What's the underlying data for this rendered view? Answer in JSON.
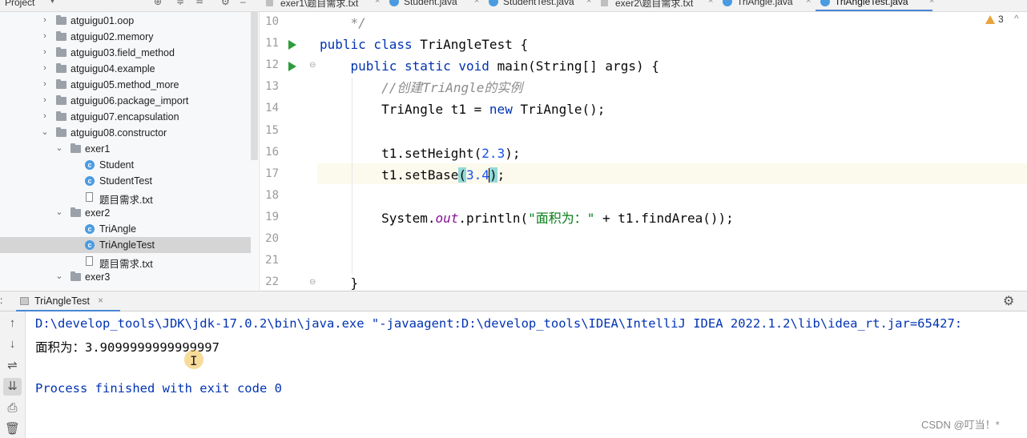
{
  "project_panel": {
    "title": "Project",
    "tree": [
      {
        "label": "atguigu01.oop",
        "type": "package",
        "expanded": false
      },
      {
        "label": "atguigu02.memory",
        "type": "package",
        "expanded": false
      },
      {
        "label": "atguigu03.field_method",
        "type": "package",
        "expanded": false
      },
      {
        "label": "atguigu04.example",
        "type": "package",
        "expanded": false
      },
      {
        "label": "atguigu05.method_more",
        "type": "package",
        "expanded": false
      },
      {
        "label": "atguigu06.package_import",
        "type": "package",
        "expanded": false
      },
      {
        "label": "atguigu07.encapsulation",
        "type": "package",
        "expanded": false
      },
      {
        "label": "atguigu08.constructor",
        "type": "package",
        "expanded": true
      },
      {
        "label": "exer1",
        "type": "package",
        "expanded": true
      },
      {
        "label": "Student",
        "type": "class"
      },
      {
        "label": "StudentTest",
        "type": "class"
      },
      {
        "label": "题目需求.txt",
        "type": "text"
      },
      {
        "label": "exer2",
        "type": "package",
        "expanded": true
      },
      {
        "label": "TriAngle",
        "type": "class"
      },
      {
        "label": "TriAngleTest",
        "type": "class",
        "selected": true
      },
      {
        "label": "题目需求.txt",
        "type": "text"
      },
      {
        "label": "exer3",
        "type": "package",
        "expanded": true
      }
    ]
  },
  "editor_tabs": [
    {
      "label": "exer1\\题目需求.txt",
      "type": "text"
    },
    {
      "label": "Student.java",
      "type": "class"
    },
    {
      "label": "StudentTest.java",
      "type": "class"
    },
    {
      "label": "exer2\\题目需求.txt",
      "type": "text"
    },
    {
      "label": "TriAngle.java",
      "type": "class"
    },
    {
      "label": "TriAngleTest.java",
      "type": "class",
      "active": true
    }
  ],
  "editor": {
    "warnings_count": "3",
    "lines": [
      {
        "n": "10",
        "segments": [
          {
            "t": "    */",
            "c": "cm"
          }
        ]
      },
      {
        "n": "11",
        "run": true,
        "segments": [
          {
            "t": "public class ",
            "c": "kw"
          },
          {
            "t": "TriAngleTest {",
            "c": ""
          }
        ]
      },
      {
        "n": "12",
        "run": true,
        "segments": [
          {
            "t": "    public static void ",
            "c": "kw"
          },
          {
            "t": "main(String[] args) {",
            "c": ""
          }
        ]
      },
      {
        "n": "13",
        "segments": [
          {
            "t": "        //创建TriAngle的实例",
            "c": "cm"
          }
        ]
      },
      {
        "n": "14",
        "segments": [
          {
            "t": "        TriAngle t1 = ",
            "c": ""
          },
          {
            "t": "new ",
            "c": "kw"
          },
          {
            "t": "TriAngle();",
            "c": ""
          }
        ]
      },
      {
        "n": "15",
        "segments": []
      },
      {
        "n": "16",
        "segments": [
          {
            "t": "        t1.setHeight(",
            "c": ""
          },
          {
            "t": "2.3",
            "c": "num"
          },
          {
            "t": ");",
            "c": ""
          }
        ]
      },
      {
        "n": "17",
        "current": true,
        "segments": [
          {
            "t": "        t1.setBase",
            "c": ""
          },
          {
            "t": "(",
            "c": "phl"
          },
          {
            "t": "3.4",
            "c": "num"
          },
          {
            "t": ")",
            "c": "phl-caret"
          },
          {
            "t": ";",
            "c": ""
          }
        ]
      },
      {
        "n": "18",
        "segments": []
      },
      {
        "n": "19",
        "segments": [
          {
            "t": "        System.",
            "c": ""
          },
          {
            "t": "out",
            "c": "fld"
          },
          {
            "t": ".println(",
            "c": ""
          },
          {
            "t": "\"面积为：\"",
            "c": "str"
          },
          {
            "t": " + t1.findArea());",
            "c": ""
          }
        ]
      },
      {
        "n": "20",
        "segments": []
      },
      {
        "n": "21",
        "segments": []
      },
      {
        "n": "22",
        "segments": [
          {
            "t": "    }",
            "c": ""
          }
        ]
      }
    ]
  },
  "run_panel": {
    "label": ":",
    "tab_label": "TriAngleTest",
    "console_lines": [
      {
        "text": "D:\\develop_tools\\JDK\\jdk-17.0.2\\bin\\java.exe \"-javaagent:D:\\develop_tools\\IDEA\\IntelliJ IDEA 2022.1.2\\lib\\idea_rt.jar=65427:",
        "kind": "cmd"
      },
      {
        "text": "面积为：3.9099999999999997",
        "kind": "out"
      },
      {
        "text": "",
        "kind": "out"
      },
      {
        "text": "Process finished with exit code 0",
        "kind": "cmd"
      }
    ]
  },
  "watermark": "CSDN @叮当！*",
  "colors": {
    "keyword": "#0033b3",
    "comment": "#8c8c8c",
    "number": "#1750eb",
    "string": "#067d17",
    "field": "#871094",
    "accent": "#4a87d6",
    "run_icon": "#2f9c3c"
  }
}
